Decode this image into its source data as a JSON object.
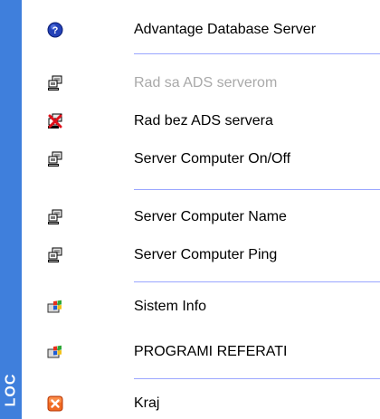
{
  "sidebar": {
    "label": "LOC",
    "color": "#3f7fdc"
  },
  "menu": {
    "items": [
      {
        "label": "Advantage Database Server",
        "icon": "help-icon",
        "enabled": true
      },
      {
        "label": "Rad sa ADS serverom",
        "icon": "network-computer-icon",
        "enabled": false
      },
      {
        "label": "Rad bez ADS servera",
        "icon": "network-disconnected-icon",
        "enabled": true
      },
      {
        "label": "Server Computer On/Off",
        "icon": "network-computer-icon",
        "enabled": true
      },
      {
        "label": "Server Computer Name",
        "icon": "network-computer-icon",
        "enabled": true
      },
      {
        "label": "Server Computer Ping",
        "icon": "network-computer-icon",
        "enabled": true
      },
      {
        "label": "Sistem Info",
        "icon": "windows-logo-icon",
        "enabled": true
      },
      {
        "label": "PROGRAMI REFERATI",
        "icon": "windows-logo-icon",
        "enabled": true
      },
      {
        "label": "Kraj",
        "icon": "close-icon",
        "enabled": true
      }
    ]
  }
}
